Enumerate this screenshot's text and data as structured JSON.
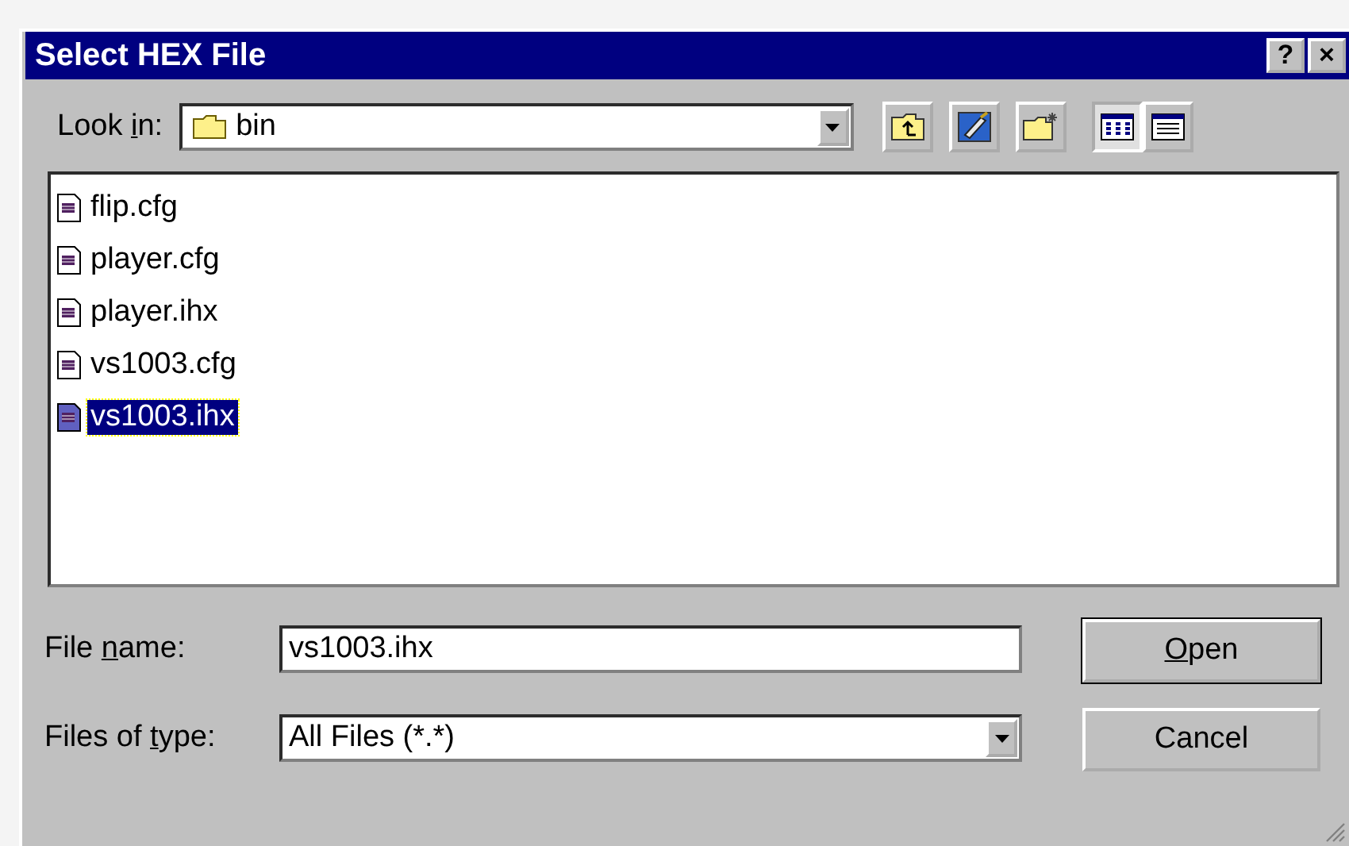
{
  "window": {
    "title": "Select HEX File",
    "title_buttons": [
      "?",
      "×"
    ]
  },
  "look_in": {
    "label": {
      "pre": "Look ",
      "key": "i",
      "post": "n:"
    },
    "value": "bin"
  },
  "toolbar": [
    {
      "kind": "up"
    },
    {
      "kind": "desktop"
    },
    {
      "kind": "new-folder"
    },
    {
      "kind": "list",
      "selected": true
    },
    {
      "kind": "details",
      "selected": false
    }
  ],
  "files": [
    {
      "name": "flip.cfg",
      "selected": false
    },
    {
      "name": "player.cfg",
      "selected": false
    },
    {
      "name": "player.ihx",
      "selected": false
    },
    {
      "name": "vs1003.cfg",
      "selected": false
    },
    {
      "name": "vs1003.ihx",
      "selected": true
    }
  ],
  "file_name": {
    "label": {
      "pre": "File ",
      "key": "n",
      "post": "ame:"
    },
    "value": "vs1003.ihx"
  },
  "file_type": {
    "label": {
      "pre": "Files of ",
      "key": "t",
      "post": "ype:"
    },
    "value": "All Files (*.*)"
  },
  "buttons": [
    {
      "label": {
        "key": "O",
        "post": "pen"
      },
      "default": true
    },
    {
      "label": {
        "pre": "Cancel"
      },
      "default": false
    }
  ]
}
